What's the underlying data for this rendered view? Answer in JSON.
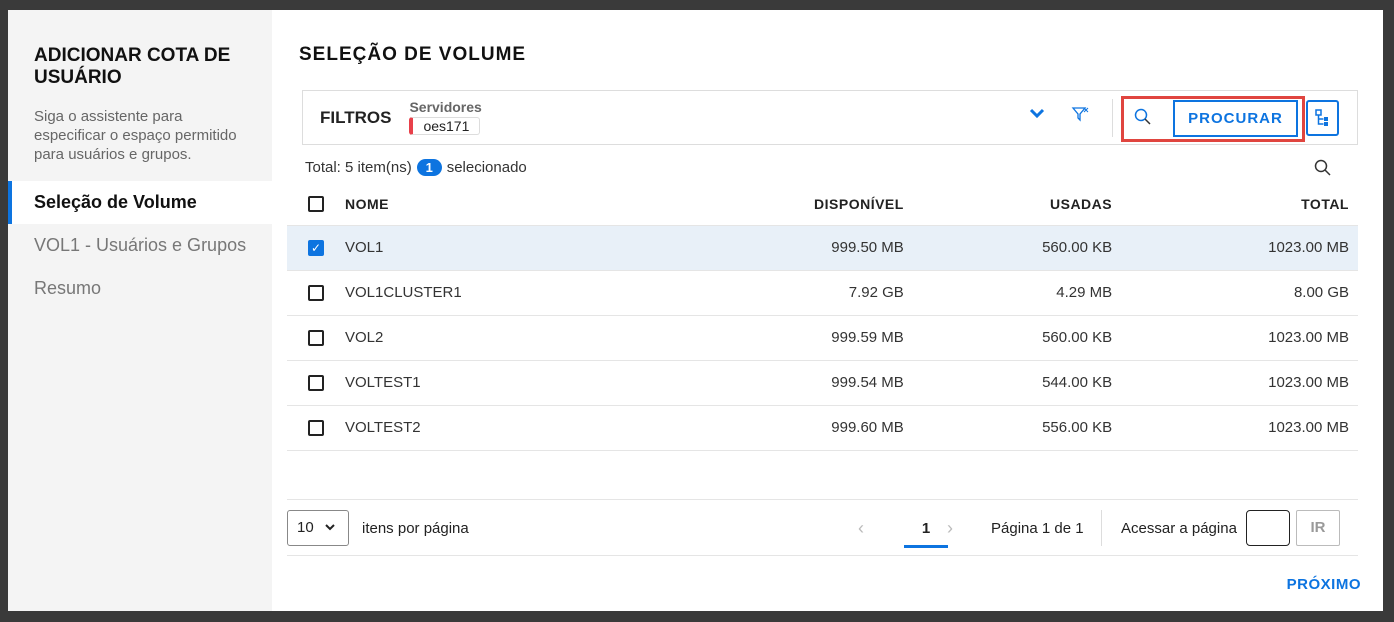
{
  "sidebar": {
    "title": "ADICIONAR COTA DE USUÁRIO",
    "description": "Siga o assistente para especificar o espaço permitido para usuários e grupos.",
    "steps": [
      {
        "label": "Seleção de Volume"
      },
      {
        "label": "VOL1 - Usuários e Grupos"
      },
      {
        "label": "Resumo"
      }
    ]
  },
  "main": {
    "title": "SELEÇÃO DE VOLUME"
  },
  "filters": {
    "label": "FILTROS",
    "servers_label": "Servidores",
    "server_chip": "oes171",
    "search_button": "PROCURAR"
  },
  "summary": {
    "total": "Total: 5 item(ns)",
    "selected_count": "1",
    "selected_label": "selecionado"
  },
  "table": {
    "headers": [
      "NOME",
      "DISPONÍVEL",
      "USADAS",
      "TOTAL"
    ],
    "rows": [
      {
        "name": "VOL1",
        "available": "999.50 MB",
        "used": "560.00 KB",
        "total": "1023.00 MB",
        "checked": true
      },
      {
        "name": "VOL1CLUSTER1",
        "available": "7.92 GB",
        "used": "4.29 MB",
        "total": "8.00 GB",
        "checked": false
      },
      {
        "name": "VOL2",
        "available": "999.59 MB",
        "used": "560.00 KB",
        "total": "1023.00 MB",
        "checked": false
      },
      {
        "name": "VOLTEST1",
        "available": "999.54 MB",
        "used": "544.00 KB",
        "total": "1023.00 MB",
        "checked": false
      },
      {
        "name": "VOLTEST2",
        "available": "999.60 MB",
        "used": "556.00 KB",
        "total": "1023.00 MB",
        "checked": false
      }
    ]
  },
  "pagination": {
    "per_page": "10",
    "per_page_label": "itens por página",
    "current_page": "1",
    "page_info": "Página 1 de 1",
    "goto_label": "Acessar a página",
    "goto_value": "",
    "go_button": "IR"
  },
  "footer": {
    "next_button": "PRÓXIMO"
  },
  "colors": {
    "accent": "#0d74e0",
    "highlight": "#e0453f"
  }
}
